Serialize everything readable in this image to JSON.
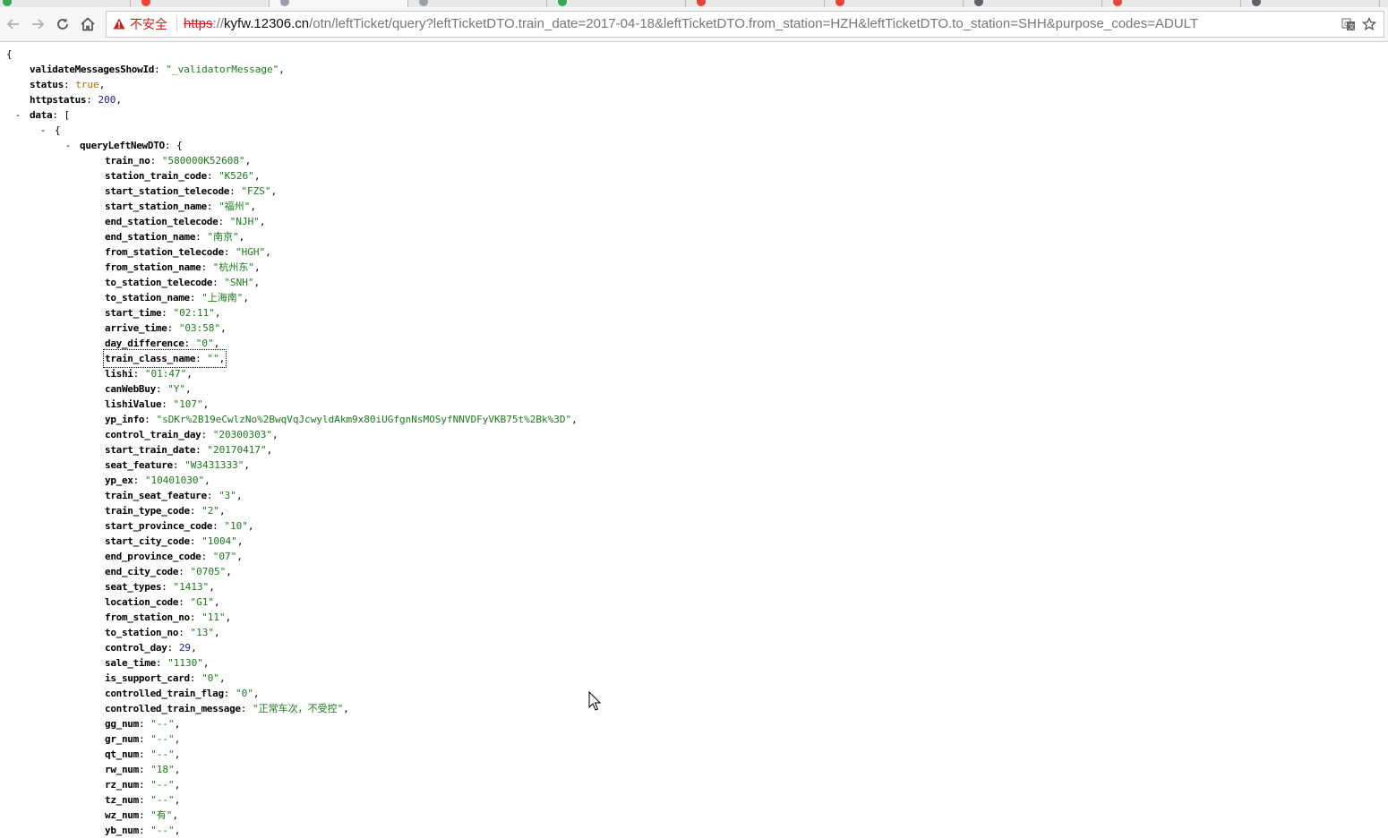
{
  "browser": {
    "security_label": "不安全",
    "url": {
      "scheme": "https",
      "sep": "://",
      "host": "kyfw.12306.cn",
      "path": "/otn/leftTicket/query?leftTicketDTO.train_date=2017-04-18&leftTicketDTO.from_station=HZH&leftTicketDTO.to_station=SHH&purpose_codes=ADULT"
    },
    "icons": [
      "back-icon",
      "forward-icon",
      "reload-icon",
      "home-icon",
      "warning-icon",
      "translate-icon",
      "star-icon"
    ],
    "tab_fav_colors": [
      "#34a853",
      "#ea4335",
      "#9aa0a6",
      "#9aa0a6",
      "#34a853",
      "#ea4335",
      "#ea4335",
      "#5f6368",
      "#ea4335",
      "#5f6368",
      "#ea4335"
    ]
  },
  "json": {
    "open_brace": "{",
    "top": [
      {
        "key": "validateMessagesShowId",
        "val": "\"_validatorMessage\"",
        "type": "s"
      },
      {
        "key": "status",
        "val": "true",
        "type": "b"
      },
      {
        "key": "httpstatus",
        "val": "200",
        "type": "n"
      }
    ],
    "data_key": "data",
    "data_open": "[",
    "item_open": "{",
    "dto_key": "queryLeftNewDTO",
    "dto_open": "{",
    "toggle": "-",
    "fields": [
      {
        "key": "train_no",
        "val": "\"580000K52608\"",
        "type": "s"
      },
      {
        "key": "station_train_code",
        "val": "\"K526\"",
        "type": "s"
      },
      {
        "key": "start_station_telecode",
        "val": "\"FZS\"",
        "type": "s"
      },
      {
        "key": "start_station_name",
        "val": "\"福州\"",
        "type": "s"
      },
      {
        "key": "end_station_telecode",
        "val": "\"NJH\"",
        "type": "s"
      },
      {
        "key": "end_station_name",
        "val": "\"南京\"",
        "type": "s"
      },
      {
        "key": "from_station_telecode",
        "val": "\"HGH\"",
        "type": "s"
      },
      {
        "key": "from_station_name",
        "val": "\"杭州东\"",
        "type": "s"
      },
      {
        "key": "to_station_telecode",
        "val": "\"SNH\"",
        "type": "s"
      },
      {
        "key": "to_station_name",
        "val": "\"上海南\"",
        "type": "s"
      },
      {
        "key": "start_time",
        "val": "\"02:11\"",
        "type": "s"
      },
      {
        "key": "arrive_time",
        "val": "\"03:58\"",
        "type": "s"
      },
      {
        "key": "day_difference",
        "val": "\"0\"",
        "type": "s"
      },
      {
        "key": "train_class_name",
        "val": "\"\"",
        "type": "s"
      },
      {
        "key": "lishi",
        "val": "\"01:47\"",
        "type": "s"
      },
      {
        "key": "canWebBuy",
        "val": "\"Y\"",
        "type": "s"
      },
      {
        "key": "lishiValue",
        "val": "\"107\"",
        "type": "s"
      },
      {
        "key": "yp_info",
        "val": "\"sDKr%2B19eCwlzNo%2BwqVqJcwyldAkm9x80iUGfgnNsMOSyfNNVDFyVKB75t%2Bk%3D\"",
        "type": "s"
      },
      {
        "key": "control_train_day",
        "val": "\"20300303\"",
        "type": "s"
      },
      {
        "key": "start_train_date",
        "val": "\"20170417\"",
        "type": "s"
      },
      {
        "key": "seat_feature",
        "val": "\"W3431333\"",
        "type": "s"
      },
      {
        "key": "yp_ex",
        "val": "\"10401030\"",
        "type": "s"
      },
      {
        "key": "train_seat_feature",
        "val": "\"3\"",
        "type": "s"
      },
      {
        "key": "train_type_code",
        "val": "\"2\"",
        "type": "s"
      },
      {
        "key": "start_province_code",
        "val": "\"10\"",
        "type": "s"
      },
      {
        "key": "start_city_code",
        "val": "\"1004\"",
        "type": "s"
      },
      {
        "key": "end_province_code",
        "val": "\"07\"",
        "type": "s"
      },
      {
        "key": "end_city_code",
        "val": "\"0705\"",
        "type": "s"
      },
      {
        "key": "seat_types",
        "val": "\"1413\"",
        "type": "s"
      },
      {
        "key": "location_code",
        "val": "\"G1\"",
        "type": "s"
      },
      {
        "key": "from_station_no",
        "val": "\"11\"",
        "type": "s"
      },
      {
        "key": "to_station_no",
        "val": "\"13\"",
        "type": "s"
      },
      {
        "key": "control_day",
        "val": "29",
        "type": "n"
      },
      {
        "key": "sale_time",
        "val": "\"1130\"",
        "type": "s"
      },
      {
        "key": "is_support_card",
        "val": "\"0\"",
        "type": "s"
      },
      {
        "key": "controlled_train_flag",
        "val": "\"0\"",
        "type": "s"
      },
      {
        "key": "controlled_train_message",
        "val": "\"正常车次，不受控\"",
        "type": "s"
      },
      {
        "key": "gg_num",
        "val": "\"--\"",
        "type": "s"
      },
      {
        "key": "gr_num",
        "val": "\"--\"",
        "type": "s"
      },
      {
        "key": "qt_num",
        "val": "\"--\"",
        "type": "s"
      },
      {
        "key": "rw_num",
        "val": "\"18\"",
        "type": "s"
      },
      {
        "key": "rz_num",
        "val": "\"--\"",
        "type": "s"
      },
      {
        "key": "tz_num",
        "val": "\"--\"",
        "type": "s"
      },
      {
        "key": "wz_num",
        "val": "\"有\"",
        "type": "s"
      },
      {
        "key": "yb_num",
        "val": "\"--\"",
        "type": "s"
      }
    ]
  }
}
